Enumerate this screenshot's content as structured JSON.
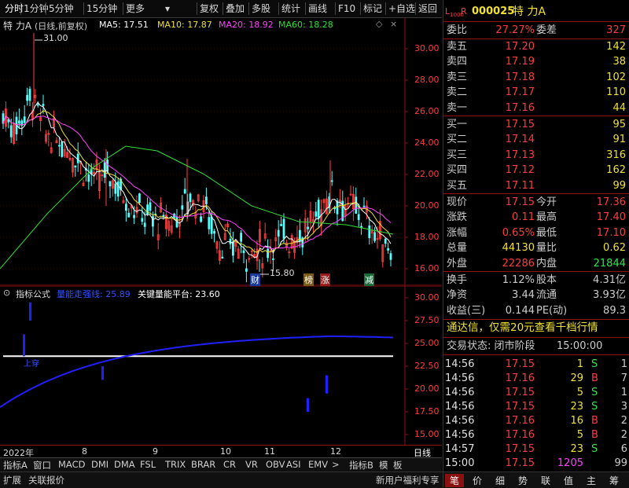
{
  "toolbar": {
    "items": [
      "分时",
      "1分钟",
      "5分钟",
      "15分钟",
      "更多",
      "复权",
      "叠加",
      "多股",
      "统计",
      "画线",
      "F10",
      "标记",
      "+自选",
      "返回"
    ]
  },
  "chart": {
    "stock_label": "特 力A",
    "adj_label": "(日线,前复权)",
    "ma_labels": [
      "MA5: 17.51",
      "MA10: 17.87",
      "MA20: 18.92",
      "MA60: 18.28"
    ],
    "ma_colors": [
      "#ffffff",
      "#f0e030",
      "#ff40ff",
      "#30e030"
    ],
    "high_note": "31.00",
    "low_note": "15.80",
    "y_ticks": [
      "30.00",
      "28.00",
      "26.00",
      "24.00",
      "22.00",
      "20.00",
      "18.00",
      "16.00"
    ],
    "tags": [
      "财",
      "榜",
      "涨",
      "减"
    ]
  },
  "indicator": {
    "title": "指标公式",
    "line1": "量能走强线: 25.89",
    "line2": "关键量能平台: 23.60",
    "cross_label": "上穿",
    "y_ticks": [
      "30.00",
      "27.50",
      "25.00",
      "22.50",
      "20.00",
      "17.50",
      "15.00"
    ]
  },
  "xaxis": {
    "labels": [
      "2022年",
      "8",
      "9",
      "10",
      "11",
      "12"
    ],
    "period": "日线"
  },
  "bottom_tabs": [
    "指标A",
    "窗口",
    "MACD",
    "DMI",
    "DMA",
    "FSL",
    "TRIX",
    "BRAR",
    "CR",
    "VR",
    "OBV",
    "ASI",
    "EMV",
    ">",
    "指标B",
    "模",
    "板"
  ],
  "status_tabs": [
    "扩展",
    "关联报价"
  ],
  "status_right": "新用户福利专享",
  "quote": {
    "code": "000025",
    "name": "特 力A",
    "weibi": {
      "label": "委比",
      "value": "27.27%",
      "label2": "委差",
      "value2": "327"
    },
    "sells": [
      {
        "label": "卖五",
        "price": "17.20",
        "vol": "142"
      },
      {
        "label": "卖四",
        "price": "17.19",
        "vol": "38"
      },
      {
        "label": "卖三",
        "price": "17.18",
        "vol": "102"
      },
      {
        "label": "卖二",
        "price": "17.17",
        "vol": "110"
      },
      {
        "label": "卖一",
        "price": "17.16",
        "vol": "44"
      }
    ],
    "buys": [
      {
        "label": "买一",
        "price": "17.15",
        "vol": "95"
      },
      {
        "label": "买二",
        "price": "17.14",
        "vol": "91"
      },
      {
        "label": "买三",
        "price": "17.13",
        "vol": "316"
      },
      {
        "label": "买四",
        "price": "17.12",
        "vol": "162"
      },
      {
        "label": "买五",
        "price": "17.11",
        "vol": "99"
      }
    ],
    "stats": [
      {
        "l1": "现价",
        "v1": "17.15",
        "l2": "今开",
        "v2": "17.36"
      },
      {
        "l1": "涨跌",
        "v1": "0.11",
        "l2": "最高",
        "v2": "17.40"
      },
      {
        "l1": "涨幅",
        "v1": "0.65%",
        "l2": "最低",
        "v2": "17.10"
      },
      {
        "l1": "总量",
        "v1": "44130",
        "l2": "量比",
        "v2": "0.62"
      },
      {
        "l1": "外盘",
        "v1": "22286",
        "l2": "内盘",
        "v2": "21844"
      }
    ],
    "stats2": [
      {
        "l1": "换手",
        "v1": "1.12%",
        "l2": "股本",
        "v2": "4.31亿"
      },
      {
        "l1": "净资",
        "v1": "3.44",
        "l2": "流通",
        "v2": "3.93亿"
      },
      {
        "l1": "收益(三)",
        "v1": "0.144",
        "l2": "PE(动)",
        "v2": "89.3"
      }
    ],
    "ad": "通达信，仅需20元查看千档行情",
    "trade_status_label": "交易状态: 闭市阶段",
    "trade_status_time": "15:00:00",
    "ticks": [
      {
        "t": "14:56",
        "p": "17.15",
        "v": "1",
        "bs": "S",
        "n": "1"
      },
      {
        "t": "14:56",
        "p": "17.16",
        "v": "29",
        "bs": "B",
        "n": "7"
      },
      {
        "t": "14:56",
        "p": "17.15",
        "v": "5",
        "bs": "S",
        "n": "1"
      },
      {
        "t": "14:56",
        "p": "17.15",
        "v": "23",
        "bs": "S",
        "n": "3"
      },
      {
        "t": "14:56",
        "p": "17.16",
        "v": "16",
        "bs": "B",
        "n": "2"
      },
      {
        "t": "14:56",
        "p": "17.16",
        "v": "5",
        "bs": "B",
        "n": "2"
      },
      {
        "t": "14:57",
        "p": "17.15",
        "v": "23",
        "bs": "S",
        "n": "6"
      },
      {
        "t": "15:00",
        "p": "17.15",
        "v": "1205",
        "bs": "",
        "n": "99"
      }
    ],
    "tabs": [
      "笔",
      "价",
      "细",
      "势",
      "联",
      "值",
      "主",
      "筹"
    ]
  }
}
